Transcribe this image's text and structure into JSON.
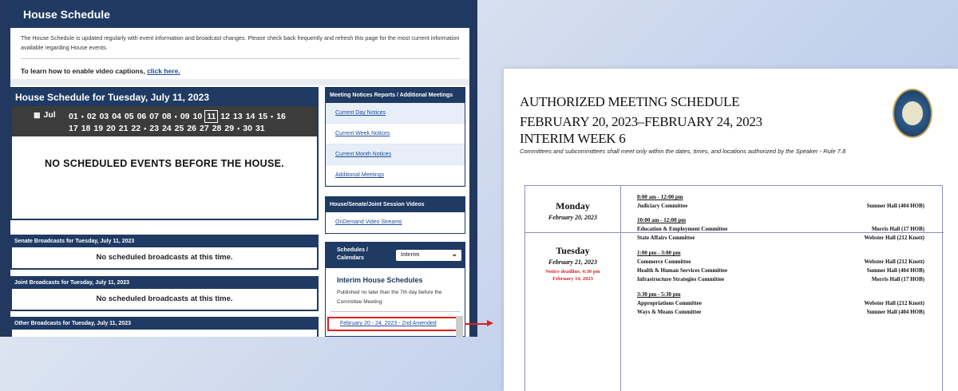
{
  "page": {
    "title": "House Schedule",
    "intro": "The House Schedule is updated regularly with event information and broadcast changes. Please check back frequently and refresh this page for the most current information available regarding House events.",
    "caption_prefix": "To learn how to enable video captions,",
    "caption_link": "click here."
  },
  "schedule": {
    "title": "House Schedule for Tuesday, July 11, 2023",
    "month": "Jul",
    "days_row1": [
      "01",
      "•",
      "02",
      "03",
      "04",
      "05",
      "06",
      "07",
      "08",
      "•",
      "09",
      "10",
      "11",
      "12",
      "13",
      "14",
      "15",
      "•",
      "16"
    ],
    "days_row2": [
      "17",
      "18",
      "19",
      "20",
      "21",
      "22",
      "•",
      "23",
      "24",
      "25",
      "26",
      "27",
      "28",
      "29",
      "•",
      "30",
      "31"
    ],
    "selected_day": "11",
    "no_events": "NO SCHEDULED EVENTS BEFORE THE HOUSE."
  },
  "broadcasts": [
    {
      "title": "Senate Broadcasts for Tuesday, July 11, 2023",
      "body": "No scheduled broadcasts at this time."
    },
    {
      "title": "Joint Broadcasts for Tuesday, July 11, 2023",
      "body": "No scheduled broadcasts at this time."
    },
    {
      "title": "Other Broadcasts for Tuesday, July 11, 2023",
      "body": ""
    }
  ],
  "notices": {
    "title": "Meeting Notices Reports / Additional Meetings",
    "items": [
      "Current Day Notices",
      "Current Week Notices",
      "Current Month Notices",
      "Additional Meetings"
    ]
  },
  "videos": {
    "title": "House/Senate/Joint Session Videos",
    "items": [
      "OnDemand Video Streams"
    ]
  },
  "calendars": {
    "title_line1": "Schedules /",
    "title_line2": "Calendars",
    "dropdown_value": "Interim",
    "heading": "Interim House Schedules",
    "published": "Published no later than the 7th day before the Committee Meeting:",
    "link": "February 20 - 24, 2023 - 2nd Amended"
  },
  "document": {
    "title1": "AUTHORIZED MEETING SCHEDULE",
    "title2": "FEBRUARY 20, 2023–FEBRUARY 24, 2023",
    "title3": "INTERIM WEEK 6",
    "rule": "Committees and subcommittees shall meet only within the dates, times, and locations authorized by the Speaker - Rule 7.8",
    "monday": {
      "day": "Monday",
      "date": "February 20, 2023"
    },
    "tuesday": {
      "day": "Tuesday",
      "date": "February 21, 2023",
      "notice1": "Notice deadline, 4:30 pm",
      "notice2": "February 14, 2023"
    },
    "slots": [
      {
        "time": "8:00 am - 12:00 pm",
        "rows": [
          {
            "name": "Judiciary Committee",
            "loc": "Sumner Hall (404 HOB)"
          }
        ]
      },
      {
        "time": "10:00 am - 12:00 pm",
        "rows": [
          {
            "name": "Education & Employment Committee",
            "loc": "Morris Hall (17 HOB)"
          },
          {
            "name": "State Affairs Committee",
            "loc": "Webster Hall (212 Knott)"
          }
        ]
      },
      {
        "time": "1:00 pm - 3:00 pm",
        "rows": [
          {
            "name": "Commerce Committee",
            "loc": "Webster Hall (212 Knott)"
          },
          {
            "name": "Health & Human Services Committee",
            "loc": "Sumner Hall (404 HOB)"
          },
          {
            "name": "Infrastructure Strategies Committee",
            "loc": "Morris Hall (17 HOB)"
          }
        ]
      },
      {
        "time": "3:30 pm - 5:30 pm",
        "rows": [
          {
            "name": "Appropriations Committee",
            "loc": "Webster Hall (212 Knott)"
          },
          {
            "name": "Ways & Means Committee",
            "loc": "Sumner Hall (404 HOB)"
          }
        ]
      }
    ]
  }
}
